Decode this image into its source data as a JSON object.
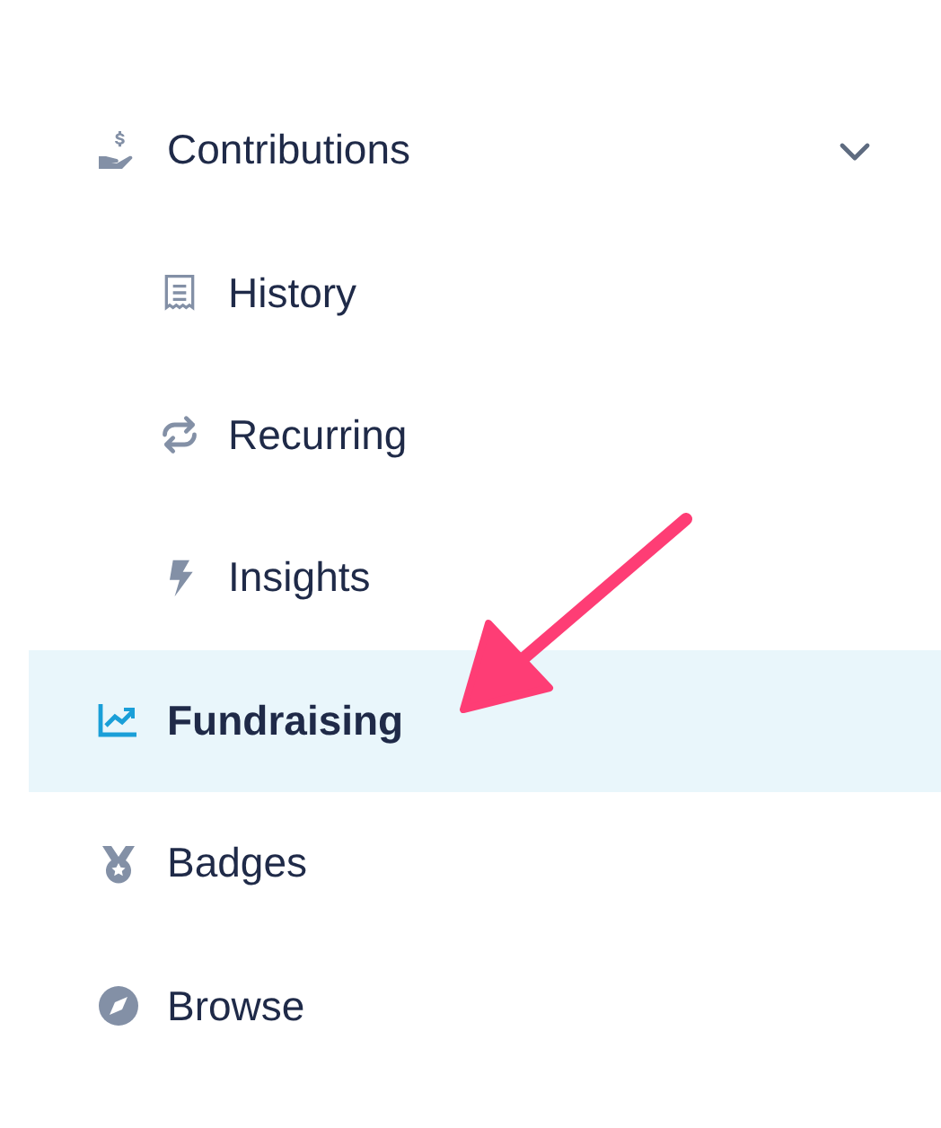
{
  "nav": [
    {
      "label": "Contributions",
      "selected": false,
      "expanded": true,
      "children": [
        {
          "label": "History",
          "selected": false
        },
        {
          "label": "Recurring",
          "selected": false
        },
        {
          "label": "Insights",
          "selected": false
        }
      ]
    },
    {
      "label": "Fundraising",
      "selected": true
    },
    {
      "label": "Badges",
      "selected": false
    },
    {
      "label": "Browse",
      "selected": false
    }
  ]
}
